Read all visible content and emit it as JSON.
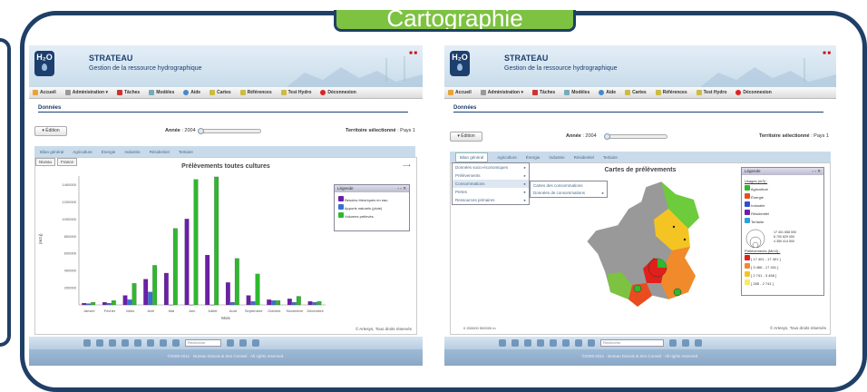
{
  "banner": {
    "label": "Cartographie"
  },
  "app": {
    "title": "STRATEAU",
    "subtitle": "Gestion de la ressource hydrographique",
    "logo_text": "H₂O"
  },
  "menu": {
    "items": [
      "Accueil",
      "Administration ▾",
      "Tâches",
      "Modèles",
      "Aide",
      "Cartes",
      "Références",
      "Test Hydro",
      "Déconnexion"
    ]
  },
  "page": {
    "section_title": "Données",
    "edit_button": "▾ Édition",
    "year_label": "Année",
    "year_value": "2004",
    "territory_label": "Territoire sélectionné",
    "territory_value": "Pays 1",
    "tabs": [
      "Bilan général",
      "Agriculture",
      "Énergie",
      "Industrie",
      "Résidentiel",
      "Tertiaire"
    ]
  },
  "left": {
    "nav_buttons": [
      "Niveau",
      "France"
    ],
    "legend_title": "Légende",
    "legend_items": [
      "Besoins théoriques en eau",
      "Apports naturels (pluie)",
      "Volumes prélevés"
    ],
    "copyright": "© Artesys, Tous droits réservés"
  },
  "chart_data": {
    "type": "bar",
    "title": "Prélèvements toutes cultures",
    "xlabel": "Mois",
    "ylabel": "(m3.j)",
    "ylim": [
      0,
      1500000
    ],
    "yticks": [
      200000,
      400000,
      600000,
      800000,
      1000000,
      1200000,
      1400000
    ],
    "categories": [
      "Janvier",
      "Février",
      "Mars",
      "Avril",
      "Mai",
      "Juin",
      "Juillet",
      "Août",
      "Septembre",
      "Octobre",
      "Novembre",
      "Décembre"
    ],
    "series": [
      {
        "name": "Besoins théoriques en eau",
        "color": "#6a1fa8",
        "values": [
          20000,
          30000,
          110000,
          300000,
          370000,
          1000000,
          580000,
          260000,
          110000,
          60000,
          70000,
          40000
        ]
      },
      {
        "name": "Apports naturels (pluie)",
        "color": "#3a6fd8",
        "values": [
          15000,
          20000,
          60000,
          150000,
          0,
          0,
          0,
          30000,
          40000,
          50000,
          30000,
          30000
        ]
      },
      {
        "name": "Volumes prélevés",
        "color": "#2eb82e",
        "values": [
          30000,
          50000,
          250000,
          460000,
          890000,
          1460000,
          1490000,
          540000,
          360000,
          50000,
          100000,
          40000
        ]
      }
    ],
    "grid": false,
    "legend": "top-right"
  },
  "right": {
    "map_title": "Cartes de prélèvements",
    "menu1": [
      "Données socio-économiques",
      "Prélèvements",
      "Consommations",
      "Pertes",
      "Ressources primaires"
    ],
    "menu2": [
      "Cartes des consommations",
      "Données de consommations"
    ],
    "legend_title": "Légende",
    "usage_title": "Usages (m3) :",
    "usages": [
      {
        "label": "Agriculture",
        "color": "#2eb82e"
      },
      {
        "label": "Énergie",
        "color": "#e84c1f"
      },
      {
        "label": "Industrie",
        "color": "#2f4fd0"
      },
      {
        "label": "Résidentiel",
        "color": "#6a1fa8"
      },
      {
        "label": "Tertiaire",
        "color": "#2ea0d8"
      }
    ],
    "bubble_values": [
      "17 401 658 000",
      "8 700 829 000",
      "4 350 414 500"
    ],
    "prelev_title": "Prélèvements (Mm3) :",
    "classes": [
      {
        "label": "[ 17 401 - 17 401 ]",
        "color": "#e0201a"
      },
      {
        "label": "[ 3 466 - 17 401 ]",
        "color": "#f08a2a"
      },
      {
        "label": "[ 2 741 - 3 466 ]",
        "color": "#f4c522"
      },
      {
        "label": "[ 265 - 2 741 ]",
        "color": "#f7ea6a"
      }
    ],
    "scale": "0   250000   500000 m",
    "copyright": "© Artesys, Tous droits réservés"
  },
  "bottom": {
    "search_placeholder": "Recherche"
  },
  "footer": "©2009-2011 · Bureau Danois & Zen Conseil · All rights reserved."
}
